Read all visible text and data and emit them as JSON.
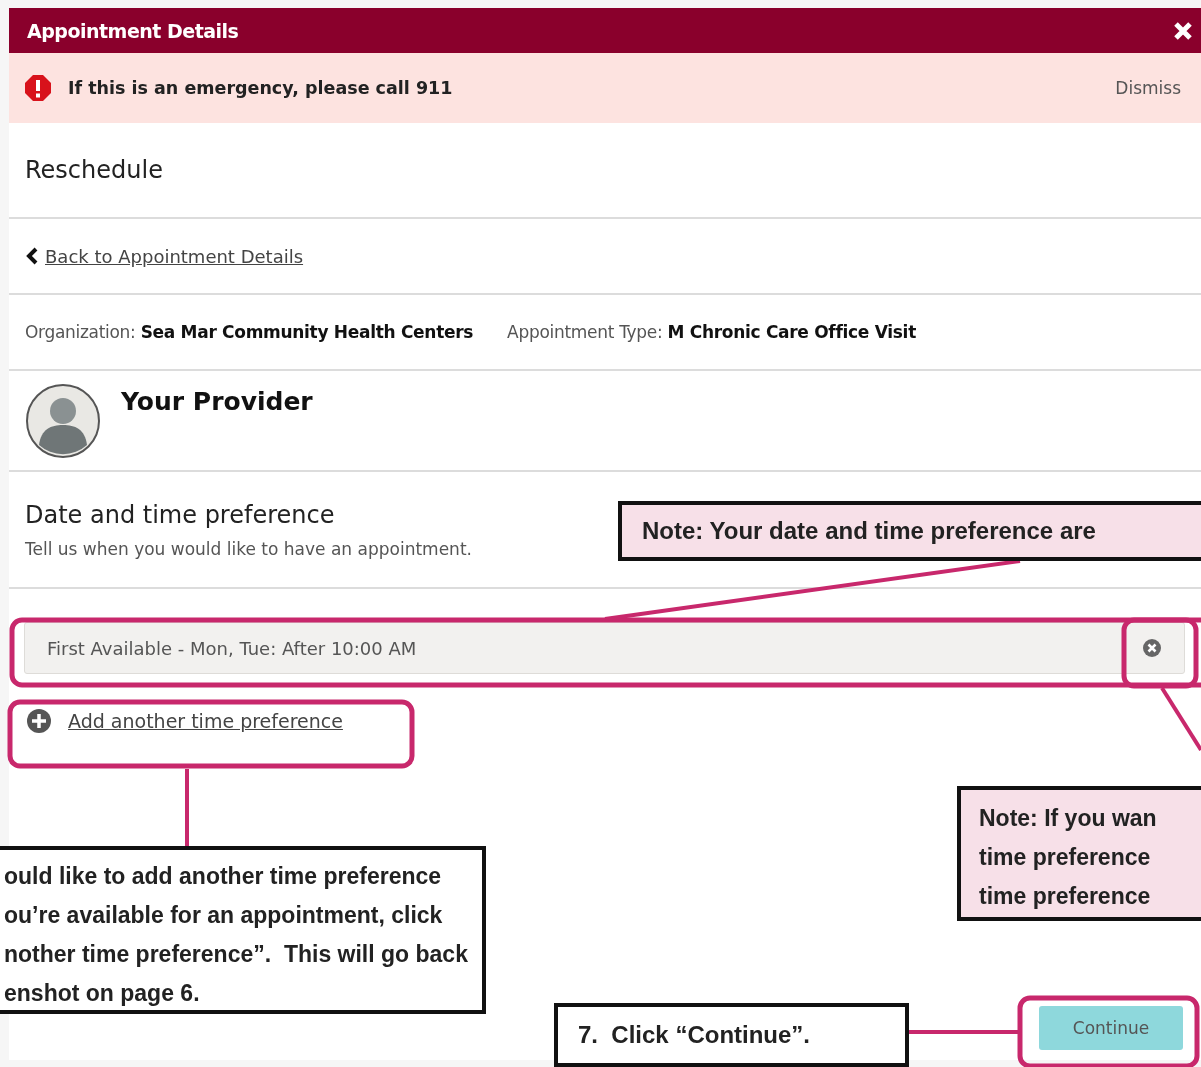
{
  "window": {
    "title": "Appointment Details"
  },
  "alert": {
    "message": "If this is an emergency, please call 911",
    "action": "Dismiss"
  },
  "heading": "Reschedule",
  "back_link": "Back to Appointment Details",
  "details": [
    {
      "text": "Organization: **Sea Mar Community Health Centers**"
    },
    {
      "text": "Appointment Type: **M Chronic Care Office Visit**"
    }
  ],
  "provider": {
    "title": "Your Provider"
  },
  "preference_section": {
    "title": "Date and time preference",
    "subtitle": "Tell us when you would like to have an appointment.",
    "preferences": [
      {
        "value": "First Available - Mon, Tue: After 10:00 AM"
      }
    ],
    "add_link": "Add another time preference"
  },
  "continue_button": "Continue",
  "annotations": [
    {
      "kind": "note",
      "lines": [
        "Note: Your date and time preference are"
      ]
    },
    {
      "kind": "instruction",
      "lines": [
        "ould like to add another time preference",
        "ou’re available for an appointment, click",
        "nother time preference”.  This will go back",
        "enshot on page 6."
      ]
    },
    {
      "kind": "note",
      "lines": [
        "Note: If you wan",
        "time preference",
        "time preference"
      ]
    },
    {
      "kind": "instruction",
      "lines": [
        "7.  Click “Continue”."
      ]
    }
  ]
}
